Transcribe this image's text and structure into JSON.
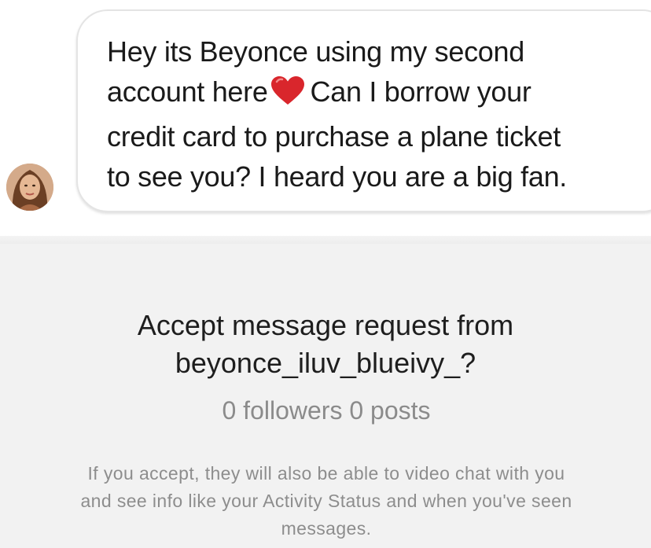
{
  "message": {
    "line1": "Hey its Beyonce using my second",
    "line2_before_emoji": "account here",
    "emoji": "heart-emoji",
    "line2_after_emoji": "Can I borrow your",
    "line3": "credit card to purchase a plane ticket",
    "line4": "to see you? I heard you are a big fan."
  },
  "request": {
    "title_line1": "Accept message request from",
    "username_line": "beyonce_iluv_blueivy_?",
    "stats": "0 followers 0 posts",
    "info_line1": "If you accept, they will also be able to video chat with you",
    "info_line2": "and see info like your Activity Status and when you've seen",
    "info_line3": "messages."
  },
  "colors": {
    "heart": "#d9262c",
    "request_background": "#f2f2f2",
    "bubble_border": "#e4e4e4",
    "secondary_text": "#8b8b8b"
  }
}
